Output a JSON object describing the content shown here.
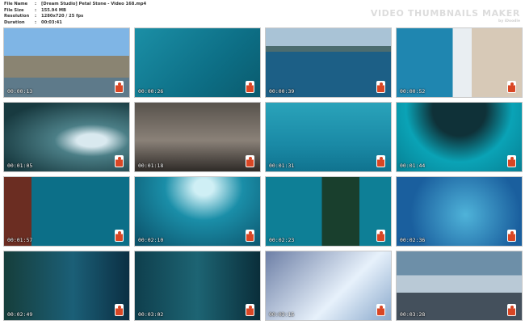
{
  "meta": {
    "rows": [
      {
        "key": "File Name",
        "value": "[Dream Studio] Petal Stone - Video 168.mp4"
      },
      {
        "key": "File Size",
        "value": "155.94 MB"
      },
      {
        "key": "Resolution",
        "value": "1280x720 / 25 fps"
      },
      {
        "key": "Duration",
        "value": "00:03:41"
      }
    ],
    "separator": ":"
  },
  "brand": {
    "title": "VIDEO THUMBNAILS MAKER",
    "subtitle": "by iDoodle"
  },
  "thumbnails": [
    {
      "timestamp": "00:00:13"
    },
    {
      "timestamp": "00:00:26"
    },
    {
      "timestamp": "00:00:39"
    },
    {
      "timestamp": "00:00:52"
    },
    {
      "timestamp": "00:01:05"
    },
    {
      "timestamp": "00:01:18"
    },
    {
      "timestamp": "00:01:31"
    },
    {
      "timestamp": "00:01:44"
    },
    {
      "timestamp": "00:01:57"
    },
    {
      "timestamp": "00:02:10"
    },
    {
      "timestamp": "00:02:23"
    },
    {
      "timestamp": "00:02:36"
    },
    {
      "timestamp": "00:02:49"
    },
    {
      "timestamp": "00:03:02"
    },
    {
      "timestamp": "00:03:15"
    },
    {
      "timestamp": "00:03:28"
    }
  ],
  "icons": {
    "watermark": "studio-logo-icon"
  }
}
